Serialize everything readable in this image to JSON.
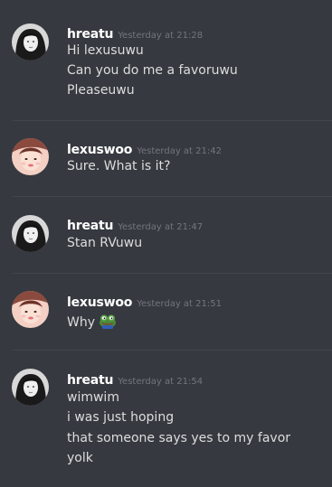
{
  "messages": [
    {
      "username": "hreatu",
      "timestamp": "Yesterday at 21:28",
      "avatar": "hreatu-avatar",
      "lines": [
        "Hi lexusuwu",
        "Can you do me a favoruwu",
        "Pleaseuwu"
      ]
    },
    {
      "username": "lexuswoo",
      "timestamp": "Yesterday at 21:42",
      "avatar": "lexuswoo-avatar",
      "lines": [
        "Sure. What is it?"
      ]
    },
    {
      "username": "hreatu",
      "timestamp": "Yesterday at 21:47",
      "avatar": "hreatu-avatar",
      "lines": [
        "Stan RVuwu"
      ]
    },
    {
      "username": "lexuswoo",
      "timestamp": "Yesterday at 21:51",
      "avatar": "lexuswoo-avatar",
      "lines": [
        "Why"
      ],
      "emoji": "pepe-frog-emoji"
    },
    {
      "username": "hreatu",
      "timestamp": "Yesterday at 21:54",
      "avatar": "hreatu-avatar",
      "lines": [
        "wimwim",
        "i was just hoping",
        "that someone says yes to my favor",
        "yolk"
      ]
    }
  ],
  "colors": {
    "background": "#36393f",
    "username": "#ffffff",
    "timestamp": "#72767d",
    "text": "#dcddde",
    "divider": "#42454a"
  }
}
